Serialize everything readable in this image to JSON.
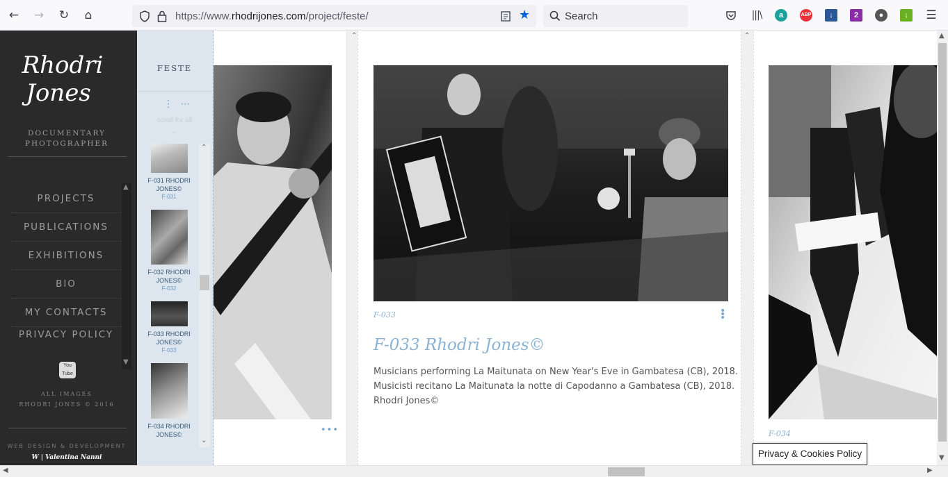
{
  "browser": {
    "url_prefix": "https://www.",
    "url_domain": "rhodrijones.com",
    "url_path": "/project/feste/",
    "search_placeholder": "Search"
  },
  "sidebar": {
    "logo_line1": "Rhodri",
    "logo_line2": "Jones",
    "tagline_line1": "DOCUMENTARY",
    "tagline_line2": "PHOTOGRAPHER",
    "menu": [
      {
        "label": "PROJECTS"
      },
      {
        "label": "PUBLICATIONS"
      },
      {
        "label": "EXHIBITIONS"
      },
      {
        "label": "BIO"
      },
      {
        "label": "MY CONTACTS"
      },
      {
        "label": "PRIVACY POLICY"
      }
    ],
    "youtube_label": "You Tube",
    "rights_line1": "ALL IMAGES",
    "rights_line2": "RHODRI JONES © 2016",
    "credit_line1": "WEB DESIGN & DEVELOPMENT",
    "credit_line2": "W | Valentina Nanni"
  },
  "thumbs": {
    "title": "FESTE",
    "scroll_hint": "scroll for all",
    "items": [
      {
        "title": "F-031 RHODRI JONES©",
        "code": "F-031"
      },
      {
        "title": "F-032 RHODRI JONES©",
        "code": "F-032"
      },
      {
        "title": "F-033 RHODRI JONES©",
        "code": "F-033"
      },
      {
        "title": "F-034 RHODRI JONES©",
        "code": ""
      }
    ]
  },
  "gallery": {
    "current": {
      "code": "F-033",
      "title": "F-033 Rhodri Jones©",
      "desc_line1": "Musicians performing La Maitunata on New Year's Eve in Gambatesa (CB), 2018.",
      "desc_line2": "Musicisti recitano La Maitunata la notte di Capodanno a Gambatesa (CB), 2018.",
      "desc_line3": "Rhodri Jones©"
    },
    "next": {
      "code": "F-034"
    }
  },
  "privacy_button": "Privacy & Cookies Policy"
}
